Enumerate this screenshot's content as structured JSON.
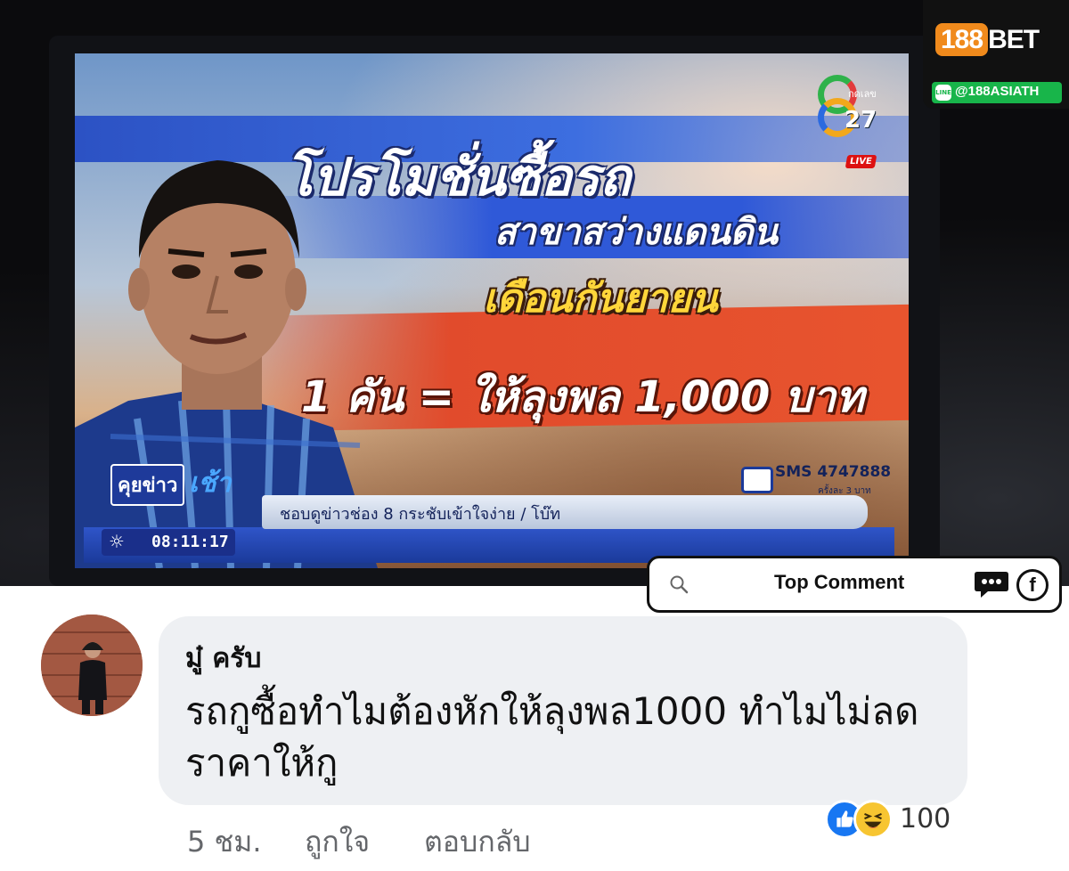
{
  "tv": {
    "headline1": "โปรโมชั่นซื้อรถ",
    "headline2": "สาขาสว่างแดนดิน",
    "headline3": "เดือนกันยายน",
    "headline4": "1 คัน = ให้ลุงพล 1,000 บาท",
    "channel_number": "27",
    "channel_small": "กดเลข",
    "live_label": "LIVE",
    "show_name_part1": "คุยข่าว",
    "show_name_part2": "เช้า",
    "ticker": "ชอบดูข่าวช่อง 8 กระชับเข้าใจง่าย / โบ๊ท",
    "clock": "08:11:17",
    "sms": "SMS 4747888",
    "sms_cost": "ครั้งละ 3 บาท"
  },
  "badge": {
    "brand_num": "188",
    "brand_text": "BET",
    "line_logo": "LINE",
    "handle": "@188ASIATH"
  },
  "topcomment": {
    "label": "Top Comment",
    "fb_letter": "f"
  },
  "comment": {
    "author": "มู๋ ครับ",
    "text_line1": "รถกูซื้อทำไมต้องหักให้ลุงพล1000 ทำไมไม่ลด",
    "text_line2": "ราคาให้กู",
    "time": "5 ชม.",
    "like_action": "ถูกใจ",
    "reply_action": "ตอบกลับ",
    "reaction_count": "100"
  },
  "icons": {
    "search": "search-icon",
    "comment_bubble": "comment-bubble-icon",
    "facebook": "facebook-icon",
    "like_reaction": "like-reaction-icon",
    "haha_reaction": "haha-reaction-icon",
    "sun": "sun-icon"
  },
  "colors": {
    "facebook_blue": "#1877f2",
    "bubble_gray": "#eef0f3",
    "line_green": "#18b54a",
    "brand_orange": "#f08a1c"
  }
}
